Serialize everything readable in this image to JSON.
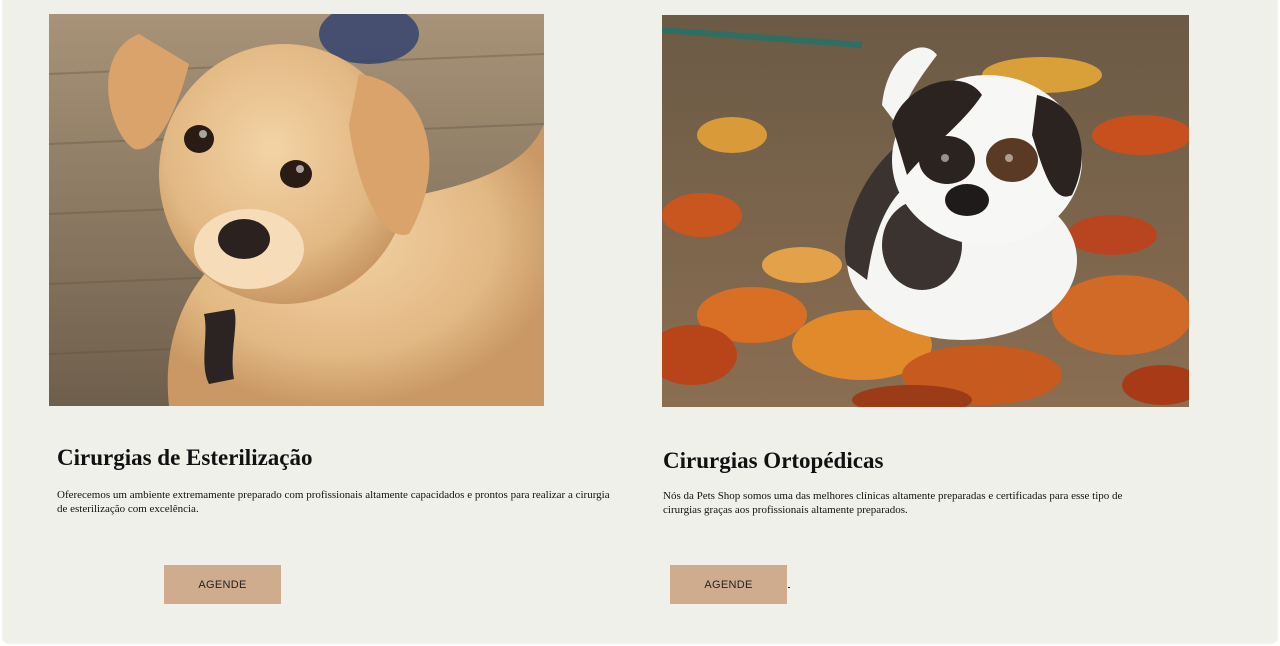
{
  "services": [
    {
      "title": "Cirurgias de Esterilização",
      "description": "Oferecemos um ambiente extremamente preparado com profissionais altamente capacidados e prontos para realizar a cirurgia de esterilização com excelência.",
      "button_label": "AGENDE",
      "image": "golden-puppy-photo"
    },
    {
      "title": "Cirurgias Ortopédicas",
      "description": "Nós da Pets Shop somos uma das melhores clínicas altamente preparadas e certificadas para esse tipo de cirurgias graças aos profissionais altamente preparados.",
      "button_label": "AGENDE",
      "image": "saint-bernard-puppy-photo"
    }
  ],
  "colors": {
    "background": "#f0f0eb",
    "button": "#cfac8e"
  }
}
